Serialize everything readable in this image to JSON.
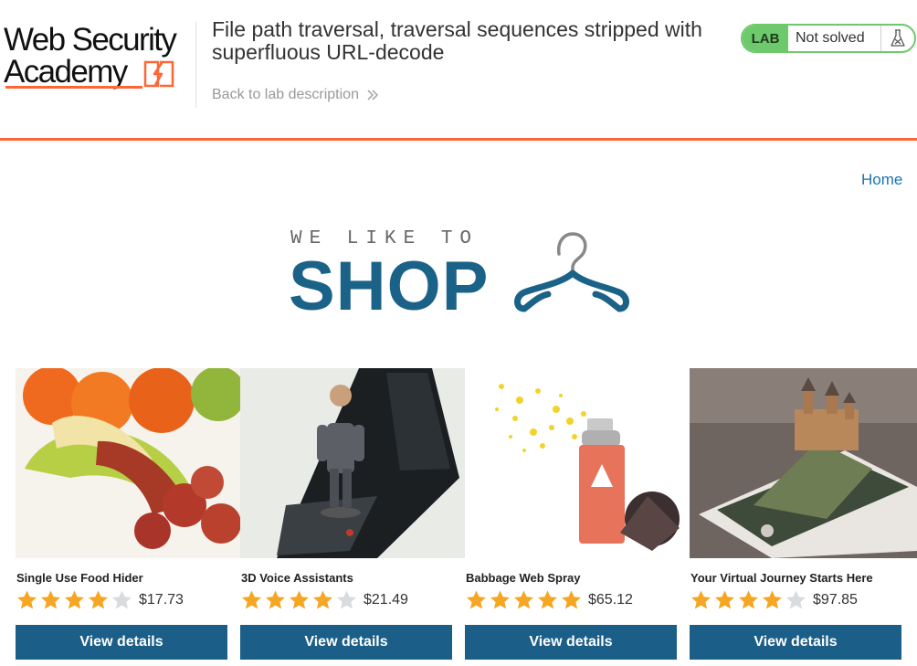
{
  "header": {
    "logo_line1": "Web Security",
    "logo_line2": "Academy",
    "lab_title": "File path traversal, traversal sequences stripped with superfluous URL-decode",
    "back_link": "Back to lab description",
    "lab_tag": "LAB",
    "lab_state": "Not solved"
  },
  "nav": {
    "home": "Home"
  },
  "banner": {
    "tagline": "WE LIKE TO",
    "title": "SHOP"
  },
  "colors": {
    "accent": "#ff6633",
    "lab_green": "#6dc96c",
    "shop_blue": "#1b6288",
    "button": "#1b5e88",
    "link": "#1a73b5",
    "star": "#f5a623"
  },
  "products": [
    {
      "name": "Single Use Food Hider",
      "rating": 4,
      "price": "$17.73",
      "button": "View details",
      "image": "food-hider-photo"
    },
    {
      "name": "3D Voice Assistants",
      "rating": 4,
      "price": "$21.49",
      "button": "View details",
      "image": "voice-assistant-photo"
    },
    {
      "name": "Babbage Web Spray",
      "rating": 5,
      "price": "$65.12",
      "button": "View details",
      "image": "web-spray-photo"
    },
    {
      "name": "Your Virtual Journey Starts Here",
      "rating": 4,
      "price": "$97.85",
      "button": "View details",
      "image": "virtual-journey-photo"
    }
  ]
}
